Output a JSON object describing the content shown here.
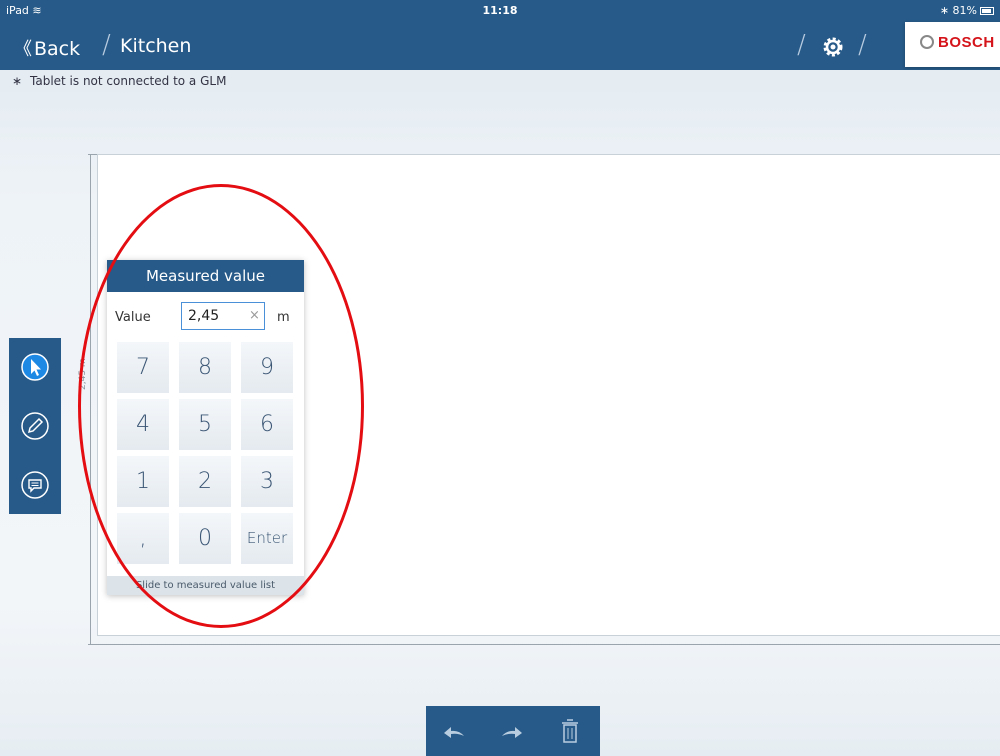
{
  "status_bar": {
    "device": "iPad",
    "time": "11:18",
    "battery": "81%"
  },
  "nav": {
    "back_label": "Back",
    "breadcrumb": "Kitchen",
    "brand": "BOSCH"
  },
  "info_bar": {
    "message": "Tablet is not connected to a GLM"
  },
  "canvas": {
    "dimension_label": "2,45 m"
  },
  "toolbar": {
    "tools": [
      "select-icon",
      "pencil-icon",
      "comment-icon"
    ]
  },
  "keypad": {
    "title": "Measured value",
    "value_label": "Value",
    "value": "2,45",
    "unit": "m",
    "keys": [
      "7",
      "8",
      "9",
      "4",
      "5",
      "6",
      "1",
      "2",
      "3",
      ",",
      "0",
      "Enter"
    ],
    "slide_hint": "Slide to measured value list"
  },
  "bottom_bar": {
    "actions": [
      "undo-icon",
      "redo-icon",
      "trash-icon"
    ]
  },
  "colors": {
    "primary": "#275a88",
    "accent_input": "#4a90d9",
    "annotation": "#e30d12",
    "brand_red": "#d4141a"
  }
}
